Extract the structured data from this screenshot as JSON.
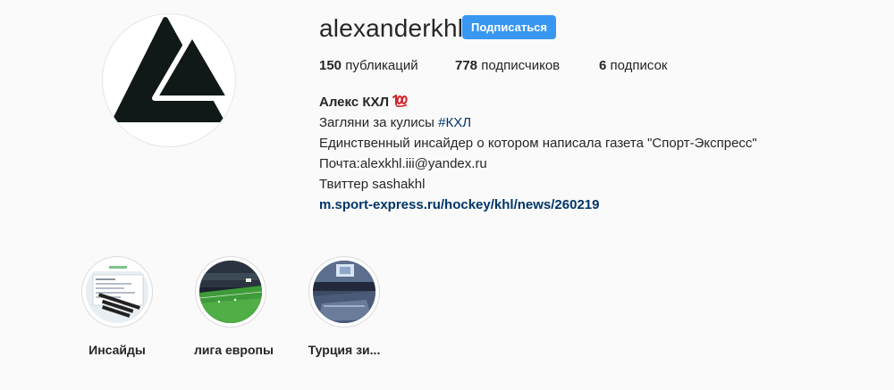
{
  "profile": {
    "username": "alexanderkhl",
    "follow_label": "Подписаться",
    "avatar_icon": "triangles-logo-icon"
  },
  "stats": {
    "posts_count": "150",
    "posts_label": " публикаций",
    "followers_count": "778",
    "followers_label": " подписчиков",
    "following_count": "6",
    "following_label": " подписок"
  },
  "bio": {
    "name": "Алекс КХЛ",
    "name_emoji": "100-emoji-icon",
    "line1_text": "Загляни за кулисы ",
    "line1_hashtag": "#КХЛ",
    "line2": "Единственный инсайдер о котором написала газета \"Спорт-Экспресс\"",
    "line3": "Почта:alexkhl.iii@yandex.ru",
    "line4": "Твиттер sashakhl",
    "link": "m.sport-express.ru/hockey/khl/news/260219"
  },
  "highlights": [
    {
      "label": "Инсайды"
    },
    {
      "label": "лига европы"
    },
    {
      "label": "Турция зи..."
    }
  ],
  "colors": {
    "accent": "#3897f0",
    "link": "#003569",
    "text": "#262626",
    "background": "#fafafa"
  }
}
